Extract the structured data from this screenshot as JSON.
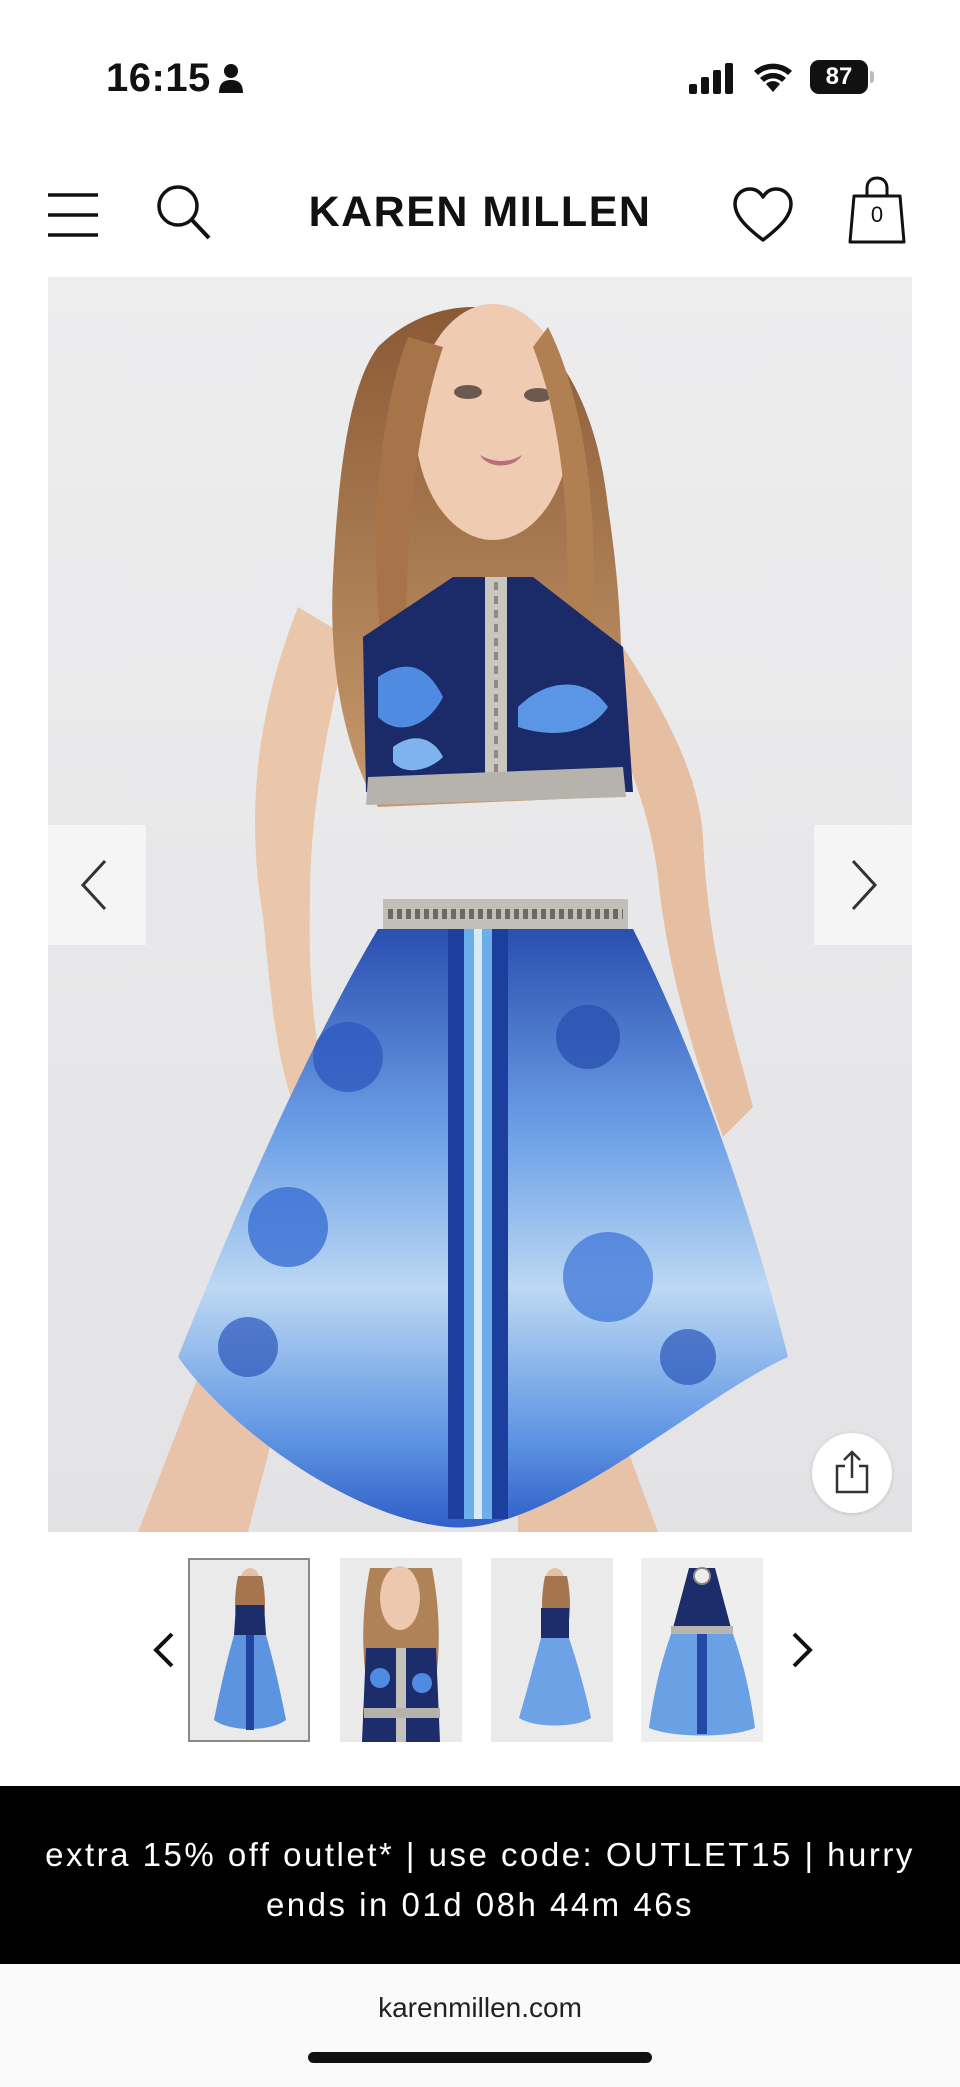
{
  "status_bar": {
    "time": "16:15",
    "battery": "87",
    "icons": [
      "person-icon",
      "signal-icon",
      "wifi-icon",
      "battery-icon"
    ]
  },
  "header": {
    "brand": "KAREN MILLEN",
    "bag_count": "0",
    "icons": [
      "menu-icon",
      "search-icon",
      "heart-icon",
      "bag-icon"
    ]
  },
  "gallery": {
    "icons": [
      "chevron-left-icon",
      "chevron-right-icon",
      "share-icon"
    ],
    "thumbnails_count": 4,
    "active_thumbnail": 1
  },
  "promo": {
    "line1": "extra 15% off outlet* | use code: OUTLET15 | hurry",
    "line2": "ends in 01d 08h 44m 46s"
  },
  "browser": {
    "url": "karenmillen.com"
  },
  "colors": {
    "promo_bg": "#000000",
    "dress_blue": "#3a78d8",
    "dress_navy": "#1a2a66",
    "page_bg": "#ffffff"
  }
}
